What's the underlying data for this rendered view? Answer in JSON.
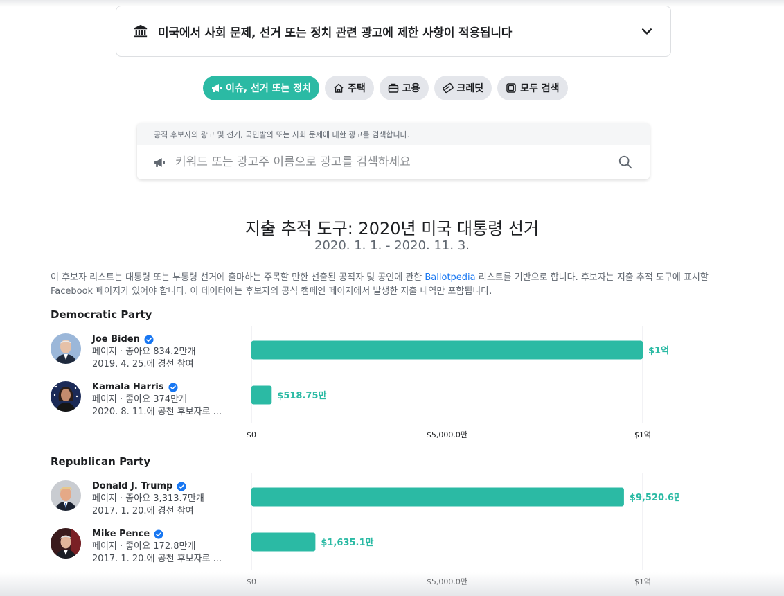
{
  "notice": {
    "text": "미국에서 사회 문제, 선거 또는 정치 관련 광고에 제한 사항이 적용됩니다",
    "icon": "bank-icon",
    "expand_icon": "chevron-down-icon"
  },
  "tabs": [
    {
      "label": "이슈, 선거 또는 정치",
      "icon": "megaphone-icon",
      "active": true
    },
    {
      "label": "주택",
      "icon": "house-icon",
      "active": false
    },
    {
      "label": "고용",
      "icon": "briefcase-icon",
      "active": false
    },
    {
      "label": "크레딧",
      "icon": "credit-card-icon",
      "active": false
    },
    {
      "label": "모두 검색",
      "icon": "square-icon",
      "active": false
    }
  ],
  "search": {
    "hint": "공직 후보자의 광고 및 선거, 국민발의 또는 사회 문제에 대한 광고를 검색합니다.",
    "placeholder": "키워드 또는 광고주 이름으로 광고를 검색하세요",
    "value": ""
  },
  "tracker": {
    "title": "지출 추적 도구: 2020년 미국 대통령 선거",
    "date_range": "2020. 1. 1. - 2020. 11. 3.",
    "description_before": "이 후보자 리스트는 대통령 또는 부통령 선거에 출마하는 주목할 만한 선출된 공직자 및 공인에 관한 ",
    "description_link": "Ballotpedia",
    "description_after": " 리스트를 기반으로 합니다. 후보자는 지출 추적 도구에 표시할 Facebook 페이지가 있어야 합니다. 이 데이터에는 후보자의 공식 캠페인 페이지에서 발생한 지출 내역만 포함됩니다."
  },
  "colors": {
    "accent": "#2bbaa4",
    "link": "#1877f2",
    "verified": "#1877f2"
  },
  "chart_data": [
    {
      "type": "bar",
      "orientation": "horizontal",
      "title": "Democratic Party",
      "categories": [
        "Joe Biden",
        "Kamala Harris"
      ],
      "values": [
        10000,
        518.75
      ],
      "value_labels": [
        "$1억",
        "$518.75만"
      ],
      "unit": "만 USD",
      "xlim": [
        0,
        10000
      ],
      "xticks": [
        0,
        5000,
        10000
      ],
      "xtick_labels": [
        "$0",
        "$5,000.0만",
        "$1억"
      ],
      "candidates": [
        {
          "name": "Joe Biden",
          "likes": "페이지 · 좋아요 834.2만개",
          "status": "2019. 4. 25.에 경선 참여"
        },
        {
          "name": "Kamala Harris",
          "likes": "페이지 · 좋아요 374만개",
          "status": "2020. 8. 11.에 공천 후보자로 ..."
        }
      ]
    },
    {
      "type": "bar",
      "orientation": "horizontal",
      "title": "Republican Party",
      "categories": [
        "Donald J. Trump",
        "Mike Pence"
      ],
      "values": [
        9520.6,
        1635.1
      ],
      "value_labels": [
        "$9,520.6만",
        "$1,635.1만"
      ],
      "unit": "만 USD",
      "xlim": [
        0,
        10000
      ],
      "xticks": [
        0,
        5000,
        10000
      ],
      "xtick_labels": [
        "$0",
        "$5,000.0만",
        "$1억"
      ],
      "candidates": [
        {
          "name": "Donald J. Trump",
          "likes": "페이지 · 좋아요 3,313.7만개",
          "status": "2017. 1. 20.에 경선 참여"
        },
        {
          "name": "Mike Pence",
          "likes": "페이지 · 좋아요 172.8만개",
          "status": "2017. 1. 20.에 공천 후보자로 ..."
        }
      ]
    }
  ]
}
